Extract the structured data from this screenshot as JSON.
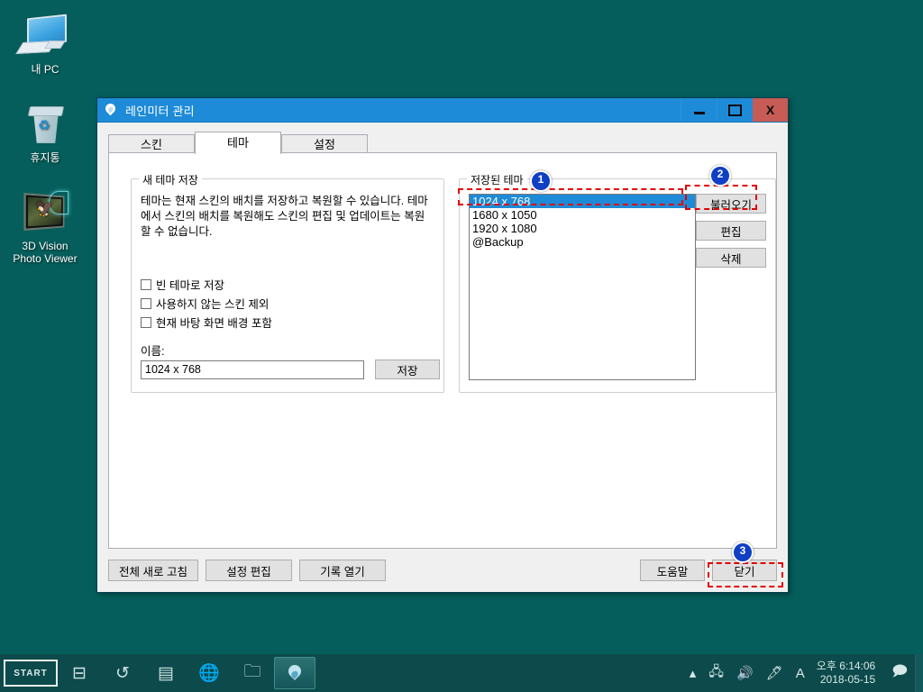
{
  "desktop": {
    "background_color": "#055e5b",
    "icons": [
      {
        "label": "내 PC",
        "icon": "computer-icon"
      },
      {
        "label": "휴지통",
        "icon": "recycle-bin-icon"
      },
      {
        "label": "3D Vision\nPhoto Viewer",
        "icon": "photo-viewer-icon"
      }
    ]
  },
  "window": {
    "title": "레인미터 관리",
    "icon": "droplet-icon",
    "titlebar_color": "#1e8bd8",
    "close_color": "#c75b55",
    "buttons": {
      "minimize": "minimize-icon",
      "maximize": "maximize-icon",
      "close": "X"
    },
    "tabs": [
      {
        "label": "스킨",
        "active": false
      },
      {
        "label": "테마",
        "active": true
      },
      {
        "label": "설정",
        "active": false
      }
    ]
  },
  "new_theme": {
    "group_title": "새 테마 저장",
    "description": "테마는 현재 스킨의 배치를 저장하고 복원할 수 있습니다. 테마에서 스킨의 배치를 복원해도 스킨의 편집 및 업데이트는 복원 할 수 없습니다.",
    "checkboxes": [
      {
        "label": "빈 테마로 저장",
        "checked": false
      },
      {
        "label": "사용하지 않는 스킨 제외",
        "checked": false
      },
      {
        "label": "현재 바탕 화면 배경 포함",
        "checked": false
      }
    ],
    "name_label": "이름:",
    "name_value": "1024 x 768",
    "name_placeholder": "",
    "save_label": "저장"
  },
  "saved_themes": {
    "group_title": "저장된 테마",
    "items": [
      {
        "label": "1024 x 768",
        "selected": true
      },
      {
        "label": "1680 x 1050",
        "selected": false
      },
      {
        "label": "1920 x 1080",
        "selected": false
      },
      {
        "label": "@Backup",
        "selected": false
      }
    ],
    "buttons": [
      {
        "label": "불러오기",
        "name": "load-theme-button"
      },
      {
        "label": "편집",
        "name": "edit-theme-button"
      },
      {
        "label": "삭제",
        "name": "delete-theme-button"
      }
    ]
  },
  "bottom_bar": {
    "refresh_all": "전체 새로 고침",
    "edit_settings": "설정 편집",
    "open_log": "기록 열기",
    "help": "도움말",
    "close": "닫기"
  },
  "annotations": {
    "highlight_color": "#e40000",
    "badge_color": "#0f3fc4",
    "steps": [
      {
        "number": "1",
        "target": "selected-theme-item"
      },
      {
        "number": "2",
        "target": "load-theme-button"
      },
      {
        "number": "3",
        "target": "close-button"
      }
    ]
  },
  "taskbar": {
    "background_color": "#0c4a4c",
    "start_label": "START",
    "items": [
      {
        "name": "task-view-icon",
        "glyph": "⊟"
      },
      {
        "name": "history-icon",
        "glyph": "↺"
      },
      {
        "name": "notes-icon",
        "glyph": "▤"
      },
      {
        "name": "browser-icon",
        "glyph": "🌐"
      },
      {
        "name": "file-explorer-icon",
        "glyph": "🗀"
      },
      {
        "name": "rainmeter-taskbar-icon",
        "glyph": "droplet"
      }
    ],
    "tray": {
      "icons": [
        {
          "name": "show-hidden-icons-chevron",
          "glyph": "▴"
        },
        {
          "name": "network-icon",
          "glyph": "🖧"
        },
        {
          "name": "volume-icon",
          "glyph": "🔊"
        },
        {
          "name": "pen-icon",
          "glyph": "🖋"
        },
        {
          "name": "ime-indicator",
          "glyph": "A"
        }
      ],
      "time": "오후 6:14:06",
      "date": "2018-05-15",
      "action_center": "🗩"
    }
  }
}
